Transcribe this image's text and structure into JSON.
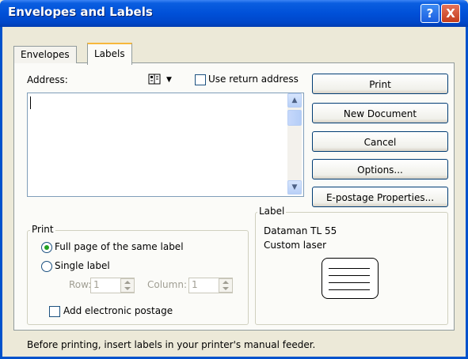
{
  "window": {
    "title": "Envelopes and Labels",
    "help_glyph": "?",
    "close_glyph": "X"
  },
  "tabs": [
    {
      "label": "Envelopes"
    },
    {
      "label": "Labels"
    }
  ],
  "address": {
    "label": "Address:",
    "value": "",
    "use_return_address": "Use return address",
    "use_return_checked": false
  },
  "buttons": {
    "print": "Print",
    "new_document": "New Document",
    "cancel": "Cancel",
    "options": "Options...",
    "epostage": "E-postage Properties..."
  },
  "print_group": {
    "title": "Print",
    "full_page": "Full page of the same label",
    "single_label": "Single label",
    "row_label": "Row:",
    "row_value": "1",
    "column_label": "Column:",
    "column_value": "1",
    "add_epostage": "Add electronic postage",
    "selected": "full_page"
  },
  "label_group": {
    "title": "Label",
    "product": "Dataman TL 55",
    "type": "Custom laser"
  },
  "footer": {
    "status": "Before printing, insert labels in your printer's manual feeder."
  },
  "colors": {
    "titlebar": "#0050d8",
    "dialog_bg": "#ece9d8"
  }
}
